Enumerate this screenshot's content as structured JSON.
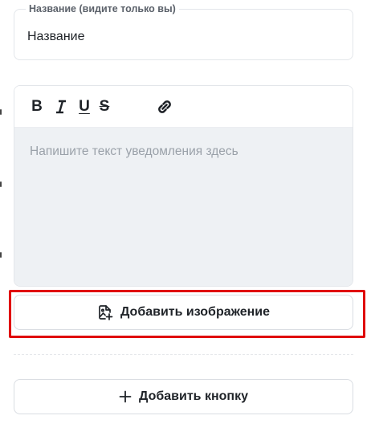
{
  "name_field": {
    "legend": "Название (видите только вы)",
    "value": "Название"
  },
  "editor": {
    "toolbar": {
      "bold": "B",
      "italic": "I",
      "underline": "U",
      "strikethrough": "S",
      "link_icon": "link-icon"
    },
    "placeholder": "Напишите текст уведомления здесь"
  },
  "add_image_button": {
    "icon": "add-image-icon",
    "label": "Добавить изображение"
  },
  "add_button": {
    "icon": "plus-icon",
    "label": "Добавить кнопку"
  },
  "colors": {
    "highlight": "#e00000",
    "text_area_bg": "#eef1f4",
    "placeholder": "#9aa1a9"
  }
}
